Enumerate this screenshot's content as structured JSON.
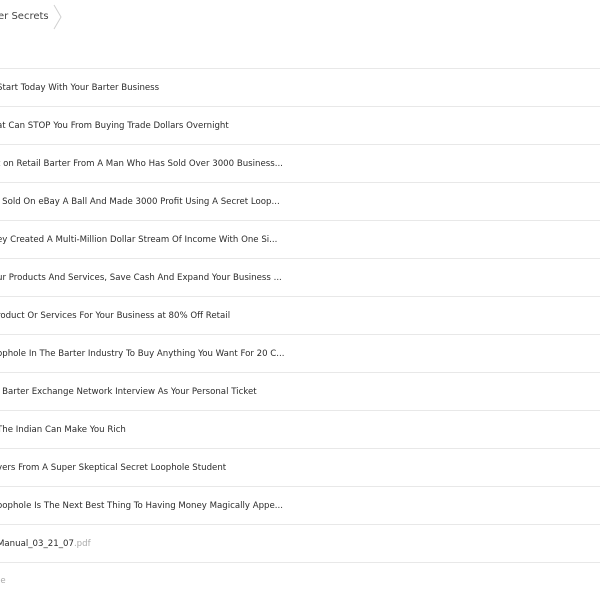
{
  "breadcrumb": {
    "label": "er Secrets"
  },
  "files": [
    {
      "name": "Start Today With Your Barter Business",
      "ext": ""
    },
    {
      "name": "at Can STOP You From Buying Trade Dollars Overnight",
      "ext": ""
    },
    {
      "name": "t on Retail Barter From A Man Who Has Sold Over 3000 Business...",
      "ext": ""
    },
    {
      "name": "l Sold On eBay A Ball And Made 3000 Profit Using A Secret Loop...",
      "ext": ""
    },
    {
      "name": "ey Created A Multi-Million Dollar Stream Of Income With One Si...",
      "ext": ""
    },
    {
      "name": "ur Products And Services, Save Cash And Expand Your Business ...",
      "ext": ""
    },
    {
      "name": "roduct Or Services For Your Business at 80% Off Retail",
      "ext": ""
    },
    {
      "name": "ophole In The Barter Industry To Buy Anything You Want For 20 C...",
      "ext": ""
    },
    {
      "name": "l Barter Exchange Network Interview As Your Personal Ticket",
      "ext": ""
    },
    {
      "name": " The Indian Can Make You Rich",
      "ext": ""
    },
    {
      "name": "vers From A Super Skeptical Secret Loophole Student",
      "ext": ""
    },
    {
      "name": "oophole Is The Next Best Thing To Having Money Magically Appe...",
      "ext": ""
    },
    {
      "name": "Manual_03_21_07",
      "ext": ".pdf"
    }
  ],
  "footer": {
    "label": "le"
  }
}
